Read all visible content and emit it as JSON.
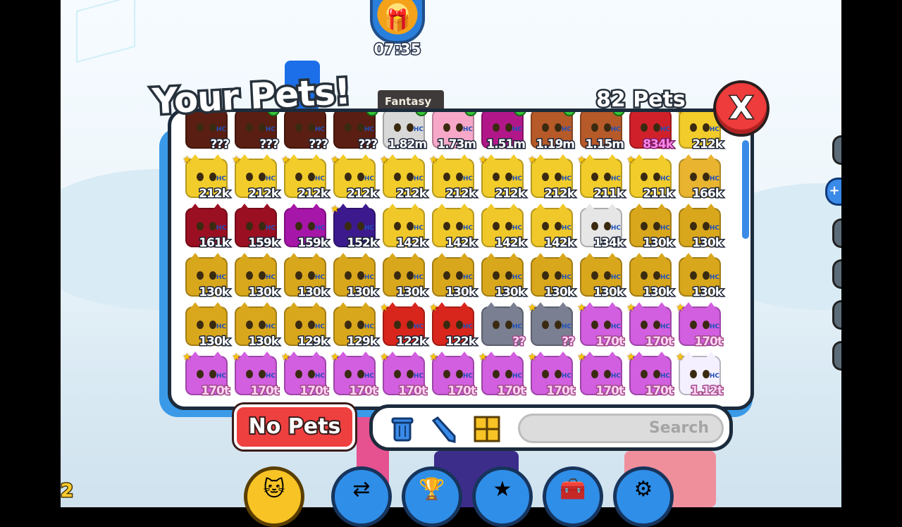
{
  "header": {
    "title": "Your Pets!",
    "pet_count": "82 Pets",
    "tab_label": "Fantasy",
    "close_label": "X"
  },
  "timer": {
    "value": "07:35"
  },
  "pets": [
    {
      "value": "???",
      "color": "#5a1e12",
      "checked": false,
      "star": false
    },
    {
      "value": "???",
      "color": "#5a1e12",
      "checked": true,
      "star": false
    },
    {
      "value": "???",
      "color": "#5a1e12",
      "checked": false,
      "star": false
    },
    {
      "value": "???",
      "color": "#5a1e12",
      "checked": true,
      "star": false
    },
    {
      "value": "1.82m",
      "color": "#d8d8d8",
      "checked": true,
      "star": false
    },
    {
      "value": "1.73m",
      "color": "#f7a8c8",
      "checked": true,
      "star": false
    },
    {
      "value": "1.51m",
      "color": "#b2178a",
      "checked": true,
      "star": false
    },
    {
      "value": "1.19m",
      "color": "#b65a2a",
      "checked": true,
      "star": false
    },
    {
      "value": "1.15m",
      "color": "#b65a2a",
      "checked": true,
      "star": false
    },
    {
      "value": "834k",
      "color": "#d0212a",
      "checked": false,
      "star": false,
      "style": "pink"
    },
    {
      "value": "212k",
      "color": "#f2cc2a",
      "checked": false,
      "star": true
    },
    {
      "value": "212k",
      "color": "#f2cc2a",
      "star": true
    },
    {
      "value": "212k",
      "color": "#f2cc2a",
      "star": true
    },
    {
      "value": "212k",
      "color": "#f2cc2a",
      "star": true
    },
    {
      "value": "212k",
      "color": "#f2cc2a",
      "star": true
    },
    {
      "value": "212k",
      "color": "#f2cc2a",
      "star": true
    },
    {
      "value": "212k",
      "color": "#f2cc2a",
      "star": true
    },
    {
      "value": "212k",
      "color": "#f2cc2a",
      "star": true
    },
    {
      "value": "212k",
      "color": "#f2cc2a",
      "star": true
    },
    {
      "value": "211k",
      "color": "#f2cc2a",
      "star": true
    },
    {
      "value": "211k",
      "color": "#f2cc2a",
      "star": true
    },
    {
      "value": "166k",
      "color": "#e9b430",
      "star": false
    },
    {
      "value": "161k",
      "color": "#9a0f22",
      "star": false
    },
    {
      "value": "159k",
      "color": "#9a0f22",
      "star": false
    },
    {
      "value": "159k",
      "color": "#a616a8",
      "star": false
    },
    {
      "value": "152k",
      "color": "#3c1a8e",
      "star": true
    },
    {
      "value": "142k",
      "color": "#f0c82a",
      "star": false
    },
    {
      "value": "142k",
      "color": "#f0c82a",
      "star": false
    },
    {
      "value": "142k",
      "color": "#f0c82a",
      "star": false
    },
    {
      "value": "142k",
      "color": "#f0c82a",
      "star": false
    },
    {
      "value": "134k",
      "color": "#e6e6e6",
      "star": false
    },
    {
      "value": "130k",
      "color": "#d9a71c",
      "star": false
    },
    {
      "value": "130k",
      "color": "#d9a71c",
      "star": false
    },
    {
      "value": "130k",
      "color": "#d9a71c",
      "star": false
    },
    {
      "value": "130k",
      "color": "#d9a71c",
      "star": false
    },
    {
      "value": "130k",
      "color": "#d9a71c",
      "star": false
    },
    {
      "value": "130k",
      "color": "#d9a71c",
      "star": false
    },
    {
      "value": "130k",
      "color": "#d9a71c",
      "star": false
    },
    {
      "value": "130k",
      "color": "#d9a71c",
      "star": false
    },
    {
      "value": "130k",
      "color": "#d9a71c",
      "star": false
    },
    {
      "value": "130k",
      "color": "#d9a71c",
      "star": false
    },
    {
      "value": "130k",
      "color": "#d9a71c",
      "star": false
    },
    {
      "value": "130k",
      "color": "#d9a71c",
      "star": false
    },
    {
      "value": "130k",
      "color": "#d9a71c",
      "star": false
    },
    {
      "value": "130k",
      "color": "#d9a71c",
      "star": false
    },
    {
      "value": "130k",
      "color": "#d9a71c",
      "star": false
    },
    {
      "value": "129k",
      "color": "#d9a71c",
      "star": false
    },
    {
      "value": "129k",
      "color": "#d9a71c",
      "star": false
    },
    {
      "value": "122k",
      "color": "#d8261c",
      "star": true
    },
    {
      "value": "122k",
      "color": "#d8261c",
      "star": true
    },
    {
      "value": "??",
      "color": "#7a7f92",
      "star": false,
      "style": "rainbow"
    },
    {
      "value": "??",
      "color": "#7a7f92",
      "star": true,
      "style": "rainbow"
    },
    {
      "value": "170t",
      "color": "#d25ee0",
      "star": true,
      "style": "rainbow"
    },
    {
      "value": "170t",
      "color": "#d25ee0",
      "star": true,
      "style": "rainbow"
    },
    {
      "value": "170t",
      "color": "#d25ee0",
      "star": true,
      "style": "rainbow"
    },
    {
      "value": "170t",
      "color": "#d25ee0",
      "star": true,
      "style": "rainbow"
    },
    {
      "value": "170t",
      "color": "#d25ee0",
      "star": true,
      "style": "rainbow"
    },
    {
      "value": "170t",
      "color": "#d25ee0",
      "star": true,
      "style": "rainbow"
    },
    {
      "value": "170t",
      "color": "#d25ee0",
      "star": true,
      "style": "rainbow"
    },
    {
      "value": "170t",
      "color": "#d25ee0",
      "star": true,
      "style": "rainbow"
    },
    {
      "value": "170t",
      "color": "#d25ee0",
      "star": true,
      "style": "rainbow"
    },
    {
      "value": "170t",
      "color": "#d25ee0",
      "star": true,
      "style": "rainbow"
    },
    {
      "value": "170t",
      "color": "#d25ee0",
      "star": true,
      "style": "rainbow"
    },
    {
      "value": "170t",
      "color": "#d25ee0",
      "star": true,
      "style": "rainbow"
    },
    {
      "value": "170t",
      "color": "#d25ee0",
      "star": true,
      "style": "rainbow"
    },
    {
      "value": "1.12t",
      "color": "#f4f0ff",
      "star": true,
      "style": "rainbow"
    }
  ],
  "hc_label": "HC",
  "actions": {
    "no_pets_label": "No Pets",
    "search_placeholder": "Search",
    "tools": [
      "trash-icon",
      "pencil-icon",
      "grid-icon"
    ]
  },
  "bottom_nav": [
    {
      "icon": "pets-icon",
      "selected": true
    },
    {
      "icon": "trade-icon",
      "selected": false
    },
    {
      "icon": "trophy-icon",
      "selected": false
    },
    {
      "icon": "star-icon",
      "selected": false
    },
    {
      "icon": "chest-icon",
      "selected": false
    },
    {
      "icon": "settings-icon",
      "selected": false
    }
  ],
  "corner_number": "2"
}
